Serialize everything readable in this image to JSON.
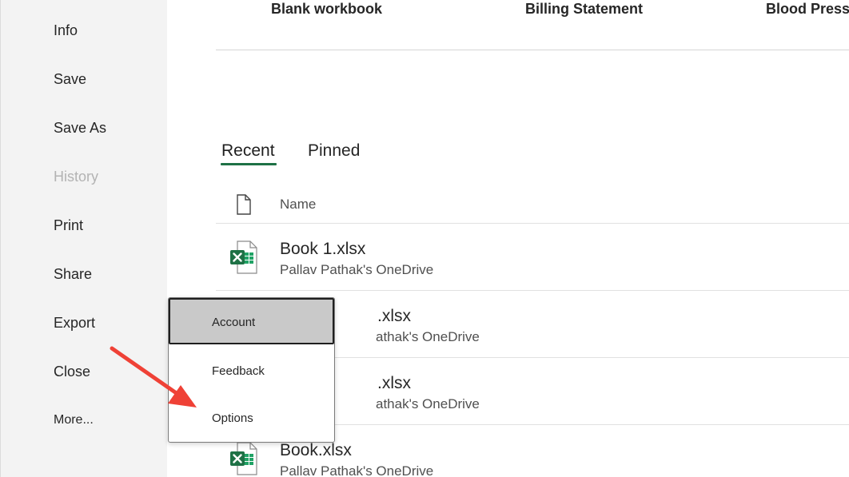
{
  "sidebar": {
    "items": [
      {
        "label": "Info",
        "enabled": true
      },
      {
        "label": "Save",
        "enabled": true
      },
      {
        "label": "Save As",
        "enabled": true
      },
      {
        "label": "History",
        "enabled": false
      },
      {
        "label": "Print",
        "enabled": true
      },
      {
        "label": "Share",
        "enabled": true
      },
      {
        "label": "Export",
        "enabled": true
      },
      {
        "label": "Close",
        "enabled": true
      },
      {
        "label": "More...",
        "enabled": true
      }
    ]
  },
  "templates": [
    "Blank workbook",
    "Billing Statement",
    "Blood Pressu"
  ],
  "tabs": {
    "recent": "Recent",
    "pinned": "Pinned",
    "active": "Recent"
  },
  "file_list": {
    "header_name": "Name",
    "files": [
      {
        "name": "Book 1.xlsx",
        "location": "Pallav Pathak's OneDrive"
      },
      {
        "name": ".xlsx",
        "location": "athak's OneDrive"
      },
      {
        "name": ".xlsx",
        "location": "athak's OneDrive"
      },
      {
        "name": "Book.xlsx",
        "location": "Pallav Pathak's OneDrive"
      }
    ]
  },
  "more_menu": {
    "items": [
      "Account",
      "Feedback",
      "Options"
    ],
    "selected": "Account"
  },
  "colors": {
    "excel_green": "#1e7145",
    "annotation_arrow": "#ef4136",
    "sidebar_bg": "#f3f3f3"
  }
}
